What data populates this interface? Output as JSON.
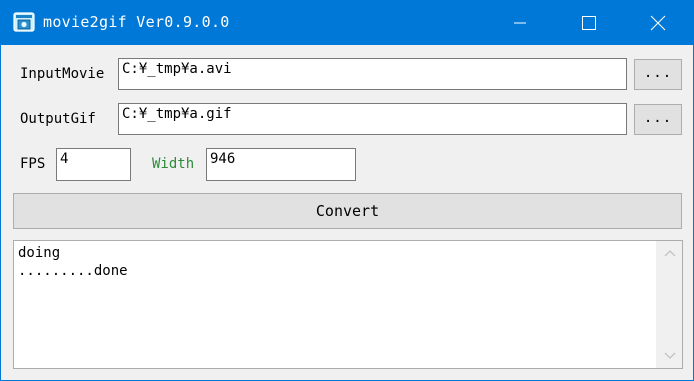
{
  "window": {
    "title": "movie2gif Ver0.9.0.0",
    "controls": {
      "minimize_icon": "minimize-icon",
      "maximize_icon": "maximize-icon",
      "close_icon": "close-icon"
    }
  },
  "form": {
    "input_movie": {
      "label": "InputMovie",
      "value": "C:¥_tmp¥a.avi",
      "browse_label": "..."
    },
    "output_gif": {
      "label": "OutputGif",
      "value": "C:¥_tmp¥a.gif",
      "browse_label": "..."
    },
    "fps": {
      "label": "FPS",
      "value": "4"
    },
    "width": {
      "label": "Width",
      "value": "946"
    },
    "convert_label": "Convert"
  },
  "log": {
    "lines": [
      "doing",
      ".........done"
    ]
  },
  "colors": {
    "titlebar": "#0078d7",
    "label_green": "#2e8b3a",
    "window_bg": "#f0f0f0",
    "button_bg": "#e1e1e1"
  }
}
